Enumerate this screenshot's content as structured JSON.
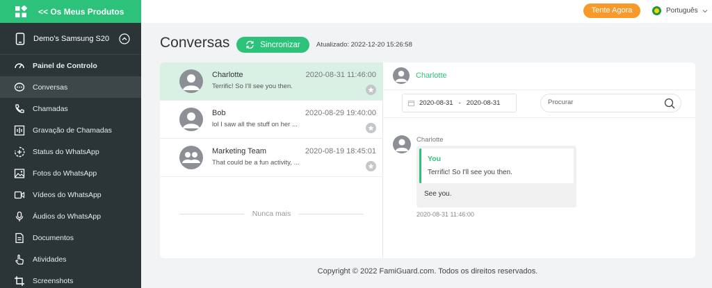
{
  "sidebar": {
    "back_label": "<< Os Meus Produtos",
    "device": "Demo's Samsung S20",
    "items": [
      {
        "label": "Painel de Controlo",
        "icon": "dashboard-icon"
      },
      {
        "label": "Conversas",
        "icon": "chat-bubble-icon"
      },
      {
        "label": "Chamadas",
        "icon": "phone-icon"
      },
      {
        "label": "Gravação de Chamadas",
        "icon": "call-recording-icon"
      },
      {
        "label": "Status do WhatsApp",
        "icon": "status-icon"
      },
      {
        "label": "Fotos do WhatsApp",
        "icon": "image-icon"
      },
      {
        "label": "Vídeos do WhatsApp",
        "icon": "video-icon"
      },
      {
        "label": "Áudios do WhatsApp",
        "icon": "microphone-icon"
      },
      {
        "label": "Documentos",
        "icon": "document-icon"
      },
      {
        "label": "Atividades",
        "icon": "hand-pointer-icon"
      },
      {
        "label": "Screenshots",
        "icon": "crop-icon"
      }
    ],
    "active_index": 1
  },
  "header": {
    "try_label": "Tente Agora",
    "language": "Português",
    "accent": "#2dc27a",
    "try_color": "#f79a2b"
  },
  "main": {
    "title": "Conversas",
    "sync_label": "Sincronizar",
    "updated": "Atualizado: 2022-12-20 15:26:58"
  },
  "conversations": [
    {
      "name": "Charlotte",
      "time": "2020-08-31 11:46:00",
      "preview": "Terrific! So I'll see you then."
    },
    {
      "name": "Bob",
      "time": "2020-08-29 19:40:00",
      "preview": "lol I saw all the stuff on her ..."
    },
    {
      "name": "Marketing Team",
      "time": "2020-08-19 18:45:01",
      "preview": "That could be a fun activity, ..."
    }
  ],
  "list_end": "Nunca mais",
  "chat": {
    "contact": "Charlotte",
    "date_from": "2020-08-31",
    "date_to": "2020-08-31",
    "search_placeholder": "Procurar",
    "message": {
      "sender": "Charlotte",
      "quote_author": "You",
      "quote_text": "Terrific! So I'll see you then.",
      "text": "See you.",
      "time": "2020-08-31 11:46:00"
    }
  },
  "footer": "Copyright © 2022 FamiGuard.com. Todos os direitos reservados."
}
